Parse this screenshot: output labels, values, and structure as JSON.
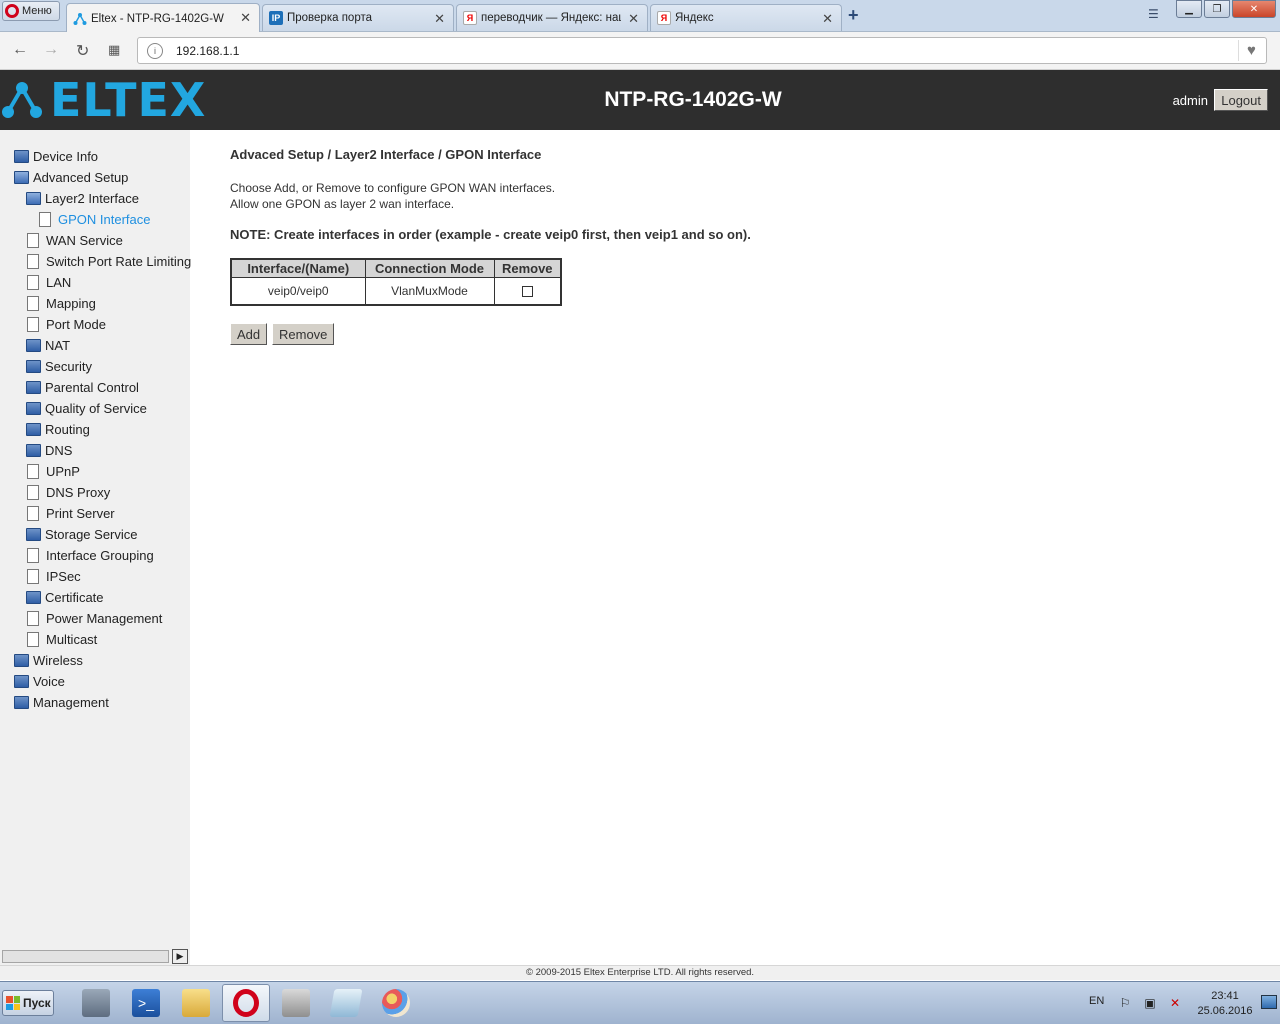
{
  "browser": {
    "menu_label": "Меню",
    "tabs": [
      {
        "title": "Eltex - NTP-RG-1402G-W",
        "close": "✕"
      },
      {
        "title": "Проверка порта",
        "close": "✕"
      },
      {
        "title": "переводчик — Яндекс: наш",
        "close": "✕"
      },
      {
        "title": "Яндекс",
        "close": "✕"
      }
    ],
    "new_tab": "+",
    "url": "192.168.1.1"
  },
  "header": {
    "logo_text": "ELTEX",
    "model": "NTP-RG-1402G-W",
    "user": "admin",
    "logout_label": "Logout"
  },
  "sidebar": {
    "items": [
      {
        "label": "Device Info"
      },
      {
        "label": "Advanced Setup"
      },
      {
        "label": "Layer2 Interface"
      },
      {
        "label": "GPON Interface"
      },
      {
        "label": "WAN Service"
      },
      {
        "label": "Switch Port Rate Limiting"
      },
      {
        "label": "LAN"
      },
      {
        "label": "Mapping"
      },
      {
        "label": "Port Mode"
      },
      {
        "label": "NAT"
      },
      {
        "label": "Security"
      },
      {
        "label": "Parental Control"
      },
      {
        "label": "Quality of Service"
      },
      {
        "label": "Routing"
      },
      {
        "label": "DNS"
      },
      {
        "label": "UPnP"
      },
      {
        "label": "DNS Proxy"
      },
      {
        "label": "Print Server"
      },
      {
        "label": "Storage Service"
      },
      {
        "label": "Interface Grouping"
      },
      {
        "label": "IPSec"
      },
      {
        "label": "Certificate"
      },
      {
        "label": "Power Management"
      },
      {
        "label": "Multicast"
      },
      {
        "label": "Wireless"
      },
      {
        "label": "Voice"
      },
      {
        "label": "Management"
      }
    ]
  },
  "main": {
    "breadcrumb": "Advaced Setup / Layer2 Interface / GPON Interface",
    "desc_line1": "Choose Add, or Remove to configure GPON WAN interfaces.",
    "desc_line2": "Allow one GPON as layer 2 wan interface.",
    "note": "NOTE: Create interfaces in order (example - create veip0 first, then veip1 and so on).",
    "table": {
      "headers": [
        "Interface/(Name)",
        "Connection Mode",
        "Remove"
      ],
      "rows": [
        {
          "interface": "veip0/veip0",
          "mode": "VlanMuxMode"
        }
      ]
    },
    "add_label": "Add",
    "remove_label": "Remove"
  },
  "footer": {
    "copyright": "© 2009-2015 Eltex Enterprise LTD. All rights reserved."
  },
  "taskbar": {
    "start_label": "Пуск",
    "lang": "EN",
    "time": "23:41",
    "date": "25.06.2016"
  },
  "colors": {
    "header_bg": "#2e2e2e",
    "brand": "#22a7e0",
    "current_nav": "#1e8fe0"
  }
}
